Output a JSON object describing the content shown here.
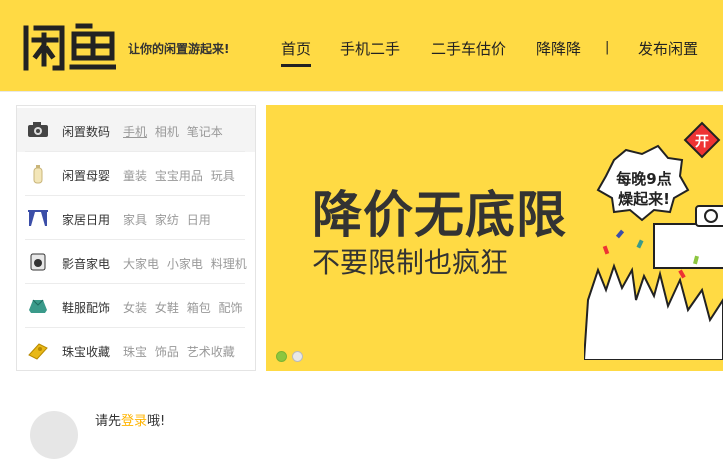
{
  "header": {
    "logo_text": "闲鱼",
    "slogan": "让你的闲置游起来!",
    "nav": [
      {
        "label": "首页",
        "active": true
      },
      {
        "label": "手机二手"
      },
      {
        "label": "二手车估价"
      },
      {
        "label": "降降降"
      },
      {
        "label": "|"
      },
      {
        "label": "发布闲置"
      }
    ]
  },
  "categories": [
    {
      "name": "闲置数码",
      "icon": "camera-icon",
      "subs": [
        "手机",
        "相机",
        "笔记本"
      ],
      "active": true
    },
    {
      "name": "闲置母婴",
      "icon": "baby-bottle-icon",
      "subs": [
        "童装",
        "宝宝用品",
        "玩具"
      ]
    },
    {
      "name": "家居日用",
      "icon": "curtain-icon",
      "subs": [
        "家具",
        "家纺",
        "日用"
      ]
    },
    {
      "name": "影音家电",
      "icon": "appliance-icon",
      "subs": [
        "大家电",
        "小家电",
        "料理机"
      ]
    },
    {
      "name": "鞋服配饰",
      "icon": "clothes-icon",
      "subs": [
        "女装",
        "女鞋",
        "箱包",
        "配饰"
      ]
    },
    {
      "name": "珠宝收藏",
      "icon": "treasure-icon",
      "subs": [
        "珠宝",
        "饰品",
        "艺术收藏"
      ]
    }
  ],
  "banner": {
    "title": "降价无底限",
    "subtitle": "不要限制也疯狂",
    "bubble_line1": "每晚9点",
    "bubble_line2": "燥起来!",
    "badge": "开",
    "slides": 2,
    "active_slide": 0
  },
  "bottom": {
    "text_prefix": "请先",
    "text_highlight": "登录",
    "text_suffix": "哦!"
  },
  "colors": {
    "brand_yellow": "#ffda44",
    "dot_active": "#8cc63f"
  }
}
